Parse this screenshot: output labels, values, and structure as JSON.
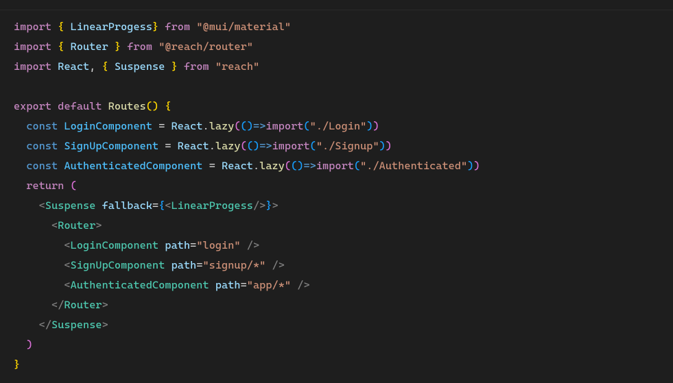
{
  "code": {
    "line1": {
      "kw_import": "import",
      "lbrace": "{",
      "ident": "LinearProgess",
      "rbrace": "}",
      "kw_from": "from",
      "str": "\"@mui/material\""
    },
    "line2": {
      "kw_import": "import",
      "lbrace": "{",
      "ident": "Router",
      "rbrace": "}",
      "kw_from": "from",
      "str": "\"@reach/router\""
    },
    "line3": {
      "kw_import": "import",
      "ident_react": "React",
      "comma": ",",
      "lbrace": "{",
      "ident_susp": "Suspense",
      "rbrace": "}",
      "kw_from": "from",
      "str": "\"reach\""
    },
    "line5": {
      "kw_export": "export",
      "kw_default": "default",
      "func": "Routes",
      "lparen": "(",
      "rparen": ")",
      "lbrace": "{"
    },
    "line6": {
      "kw_const": "const",
      "name": "LoginComponent",
      "eq": "=",
      "react": "React",
      "dot": ".",
      "lazy": "lazy",
      "l1": "(",
      "l2": "(",
      "r2_a": ")",
      "arrow": "=>",
      "importFn": "import",
      "l3": "(",
      "str": "\"./Login\"",
      "r3": ")",
      "r2": ")"
    },
    "line7": {
      "kw_const": "const",
      "name": "SignUpComponent",
      "eq": "=",
      "react": "React",
      "dot": ".",
      "lazy": "lazy",
      "l1": "(",
      "l2": "(",
      "r2_a": ")",
      "arrow": "=>",
      "importFn": "import",
      "l3": "(",
      "str": "\"./Signup\"",
      "r3": ")",
      "r2": ")"
    },
    "line8": {
      "kw_const": "const",
      "name": "AuthenticatedComponent",
      "eq": "=",
      "react": "React",
      "dot": ".",
      "lazy": "lazy",
      "l1": "(",
      "l2": "(",
      "r2_a": ")",
      "arrow": "=>",
      "importFn": "import",
      "l3": "(",
      "str": "\"./Authenticated\"",
      "r3": ")",
      "r2": ")"
    },
    "line9": {
      "kw_return": "return",
      "lparen": "("
    },
    "line10": {
      "lt": "<",
      "tag": "Suspense",
      "attr": "fallback",
      "eq": "=",
      "lbrace": "{",
      "lt2": "<",
      "comp": "LinearProgess",
      "slash": "/",
      "gt2": ">",
      "rbrace": "}",
      "gt": ">"
    },
    "line11": {
      "lt": "<",
      "tag": "Router",
      "gt": ">"
    },
    "line12": {
      "lt": "<",
      "tag": "LoginComponent",
      "attr": "path",
      "eq": "=",
      "str": "\"login\"",
      "slash": "/",
      "gt": ">"
    },
    "line13": {
      "lt": "<",
      "tag": "SignUpComponent",
      "attr": "path",
      "eq": "=",
      "str": "\"signup/*\"",
      "slash": "/",
      "gt": ">"
    },
    "line14": {
      "lt": "<",
      "tag": "AuthenticatedComponent",
      "attr": "path",
      "eq": "=",
      "str": "\"app/*\"",
      "slash": "/",
      "gt": ">"
    },
    "line15": {
      "lt": "<",
      "slash": "/",
      "tag": "Router",
      "gt": ">"
    },
    "line16": {
      "lt": "<",
      "slash": "/",
      "tag": "Suspense",
      "gt": ">"
    },
    "line17": {
      "rparen": ")"
    },
    "line18": {
      "rbrace": "}"
    }
  }
}
